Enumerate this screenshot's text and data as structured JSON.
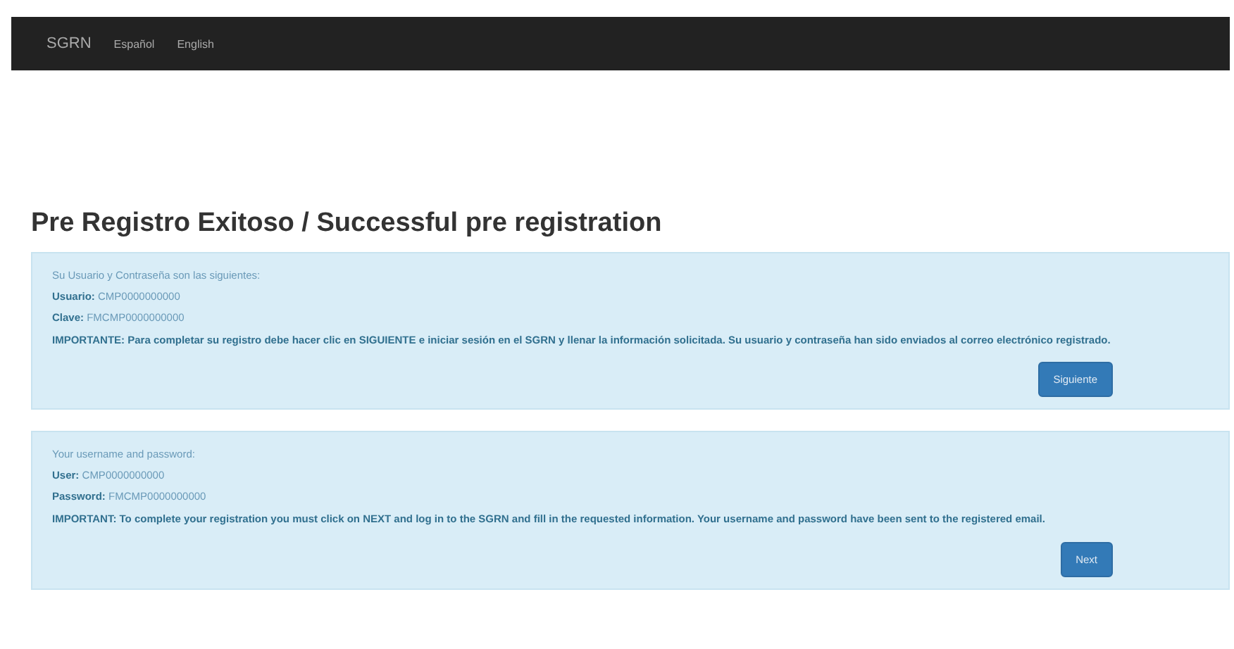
{
  "navbar": {
    "brand": "SGRN",
    "links": [
      {
        "label": "Español"
      },
      {
        "label": "English"
      }
    ]
  },
  "title": "Pre Registro Exitoso / Successful pre registration",
  "panels": [
    {
      "heading": "Su Usuario y Contraseña son las siguientes:",
      "fields": [
        {
          "label": "Usuario:",
          "value": "CMP0000000000"
        },
        {
          "label": "Clave:",
          "value": "FMCMP0000000000"
        }
      ],
      "notice": "IMPORTANTE: Para completar su registro debe hacer clic en SIGUIENTE e iniciar sesión en el SGRN y llenar la información solicitada. Su usuario y contraseña han sido enviados al correo electrónico registrado.",
      "button": "Siguiente"
    },
    {
      "heading": "Your username and password:",
      "fields": [
        {
          "label": "User:",
          "value": "CMP0000000000"
        },
        {
          "label": "Password:",
          "value": "FMCMP0000000000"
        }
      ],
      "notice": "IMPORTANT: To complete your registration you must click on NEXT and log in to the SGRN and fill in the requested information. Your username and password have been sent to the registered email.",
      "button": "Next"
    }
  ]
}
